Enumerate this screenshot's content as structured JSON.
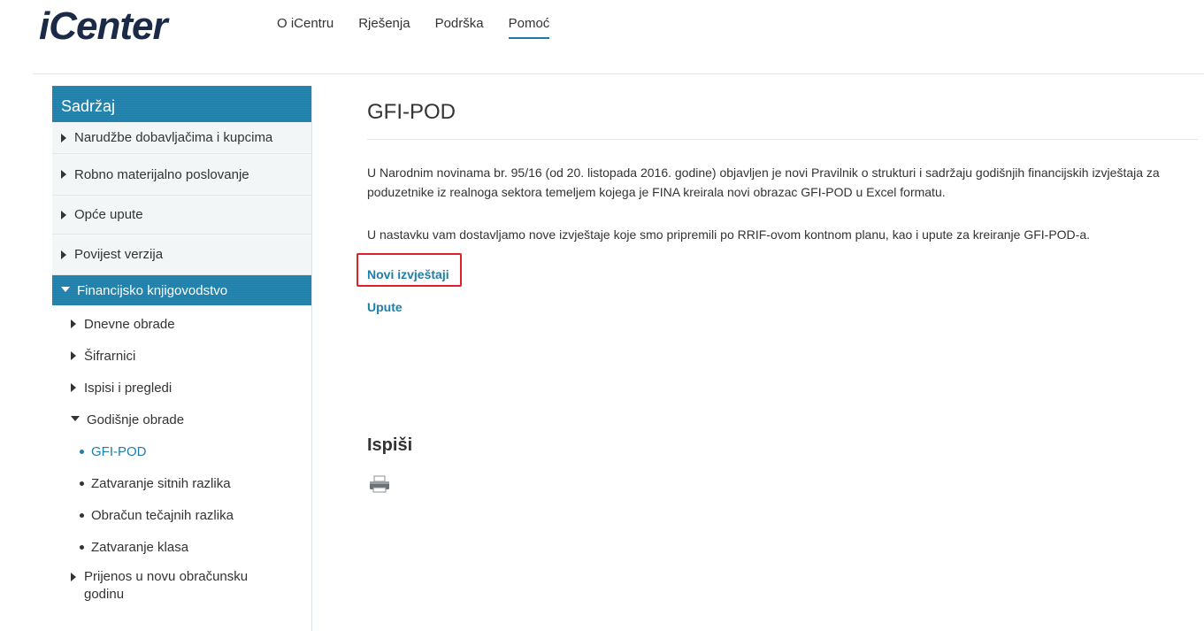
{
  "header": {
    "logo_text": "iCenter",
    "nav": [
      {
        "label": "O iCentru",
        "active": false
      },
      {
        "label": "Rješenja",
        "active": false
      },
      {
        "label": "Podrška",
        "active": false
      },
      {
        "label": "Pomoć",
        "active": true
      }
    ]
  },
  "sidebar": {
    "title": "Sadržaj",
    "items": [
      {
        "label": "Narudžbe dobavljačima i kupcima"
      },
      {
        "label": "Robno materijalno poslovanje"
      },
      {
        "label": "Opće upute"
      },
      {
        "label": "Povijest verzija"
      }
    ],
    "active_section": {
      "label": "Financijsko knjigovodstvo",
      "children": [
        {
          "label": "Dnevne obrade"
        },
        {
          "label": "Šifrarnici"
        },
        {
          "label": "Ispisi i pregledi"
        },
        {
          "label": "Godišnje obrade"
        }
      ],
      "leaves": [
        {
          "label": "GFI-POD",
          "current": true
        },
        {
          "label": "Zatvaranje sitnih razlika"
        },
        {
          "label": "Obračun tečajnih razlika"
        },
        {
          "label": "Zatvaranje klasa"
        }
      ],
      "last_child": "Prijenos u novu obračunsku godinu"
    }
  },
  "main": {
    "title": "GFI-POD",
    "paragraph1": "U Narodnim novinama br. 95/16 (od 20. listopada 2016. godine) objavljen je novi Pravilnik o strukturi i sadržaju godišnjih financijskih izvještaja za poduzetnike iz realnoga sektora temeljem kojega je FINA kreirala novi obrazac GFI-POD u Excel formatu.",
    "paragraph2": "U nastavku vam dostavljamo nove izvještaje koje smo pripremili po RRIF-ovom kontnom planu, kao i upute za kreiranje GFI-POD-a.",
    "link_new_reports": "Novi izvještaji",
    "link_instructions": "Upute",
    "print_heading": "Ispiši",
    "print_icon": "printer-icon"
  },
  "colors": {
    "accent": "#1f7ea8",
    "highlight_box": "#e0202a"
  }
}
